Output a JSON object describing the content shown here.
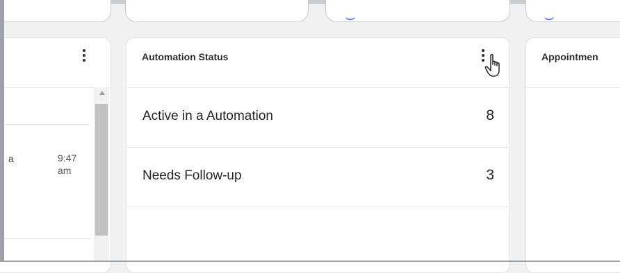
{
  "automation_status": {
    "title": "Automation Status",
    "rows": [
      {
        "label": "Active in a Automation",
        "count": "8"
      },
      {
        "label": "Needs Follow-up",
        "count": "3"
      }
    ]
  },
  "appointments": {
    "title": "Appointmen"
  },
  "left_card": {
    "row_text": "a",
    "time": "9:47 am"
  },
  "colors": {
    "accent": "#4d7fe6",
    "card_border": "#dfe1e5",
    "scroll_thumb": "#c1c1c1"
  }
}
